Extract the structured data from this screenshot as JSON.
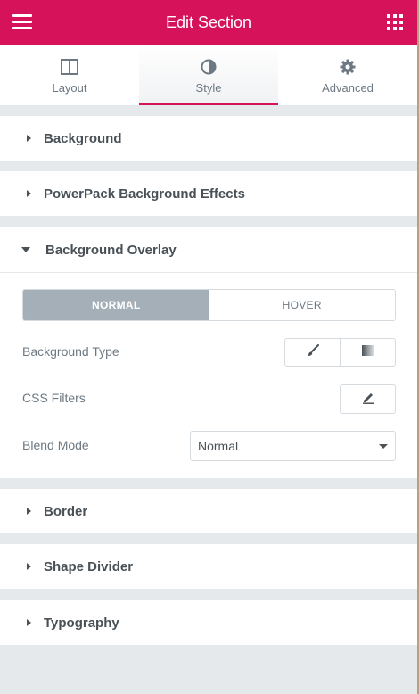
{
  "header": {
    "title": "Edit Section",
    "menu_icon": "hamburger-icon",
    "apps_icon": "grid-icon",
    "background": "#d5125a"
  },
  "tabs": [
    {
      "label": "Layout",
      "icon": "columns-icon",
      "active": false
    },
    {
      "label": "Style",
      "icon": "half-circle-icon",
      "active": true
    },
    {
      "label": "Advanced",
      "icon": "gear-icon",
      "active": false
    }
  ],
  "sections": {
    "background": {
      "title": "Background"
    },
    "powerpack": {
      "title": "PowerPack Background Effects"
    },
    "overlay": {
      "title": "Background Overlay",
      "state_toggle": {
        "normal": "NORMAL",
        "hover": "HOVER",
        "selected": "NORMAL"
      },
      "background_type": {
        "label": "Background Type",
        "options": [
          "brush-icon",
          "gradient-icon"
        ]
      },
      "css_filters": {
        "label": "CSS Filters",
        "icon": "pencil-icon"
      },
      "blend_mode": {
        "label": "Blend Mode",
        "value": "Normal"
      }
    },
    "border": {
      "title": "Border"
    },
    "shape_divider": {
      "title": "Shape Divider"
    },
    "typography": {
      "title": "Typography"
    }
  }
}
